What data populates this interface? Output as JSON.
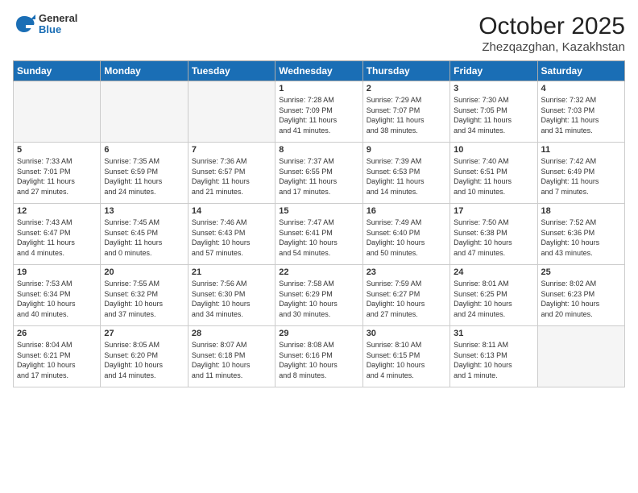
{
  "header": {
    "logo_general": "General",
    "logo_blue": "Blue",
    "month": "October 2025",
    "location": "Zhezqazghan, Kazakhstan"
  },
  "weekdays": [
    "Sunday",
    "Monday",
    "Tuesday",
    "Wednesday",
    "Thursday",
    "Friday",
    "Saturday"
  ],
  "weeks": [
    [
      {
        "day": "",
        "info": ""
      },
      {
        "day": "",
        "info": ""
      },
      {
        "day": "",
        "info": ""
      },
      {
        "day": "1",
        "info": "Sunrise: 7:28 AM\nSunset: 7:09 PM\nDaylight: 11 hours\nand 41 minutes."
      },
      {
        "day": "2",
        "info": "Sunrise: 7:29 AM\nSunset: 7:07 PM\nDaylight: 11 hours\nand 38 minutes."
      },
      {
        "day": "3",
        "info": "Sunrise: 7:30 AM\nSunset: 7:05 PM\nDaylight: 11 hours\nand 34 minutes."
      },
      {
        "day": "4",
        "info": "Sunrise: 7:32 AM\nSunset: 7:03 PM\nDaylight: 11 hours\nand 31 minutes."
      }
    ],
    [
      {
        "day": "5",
        "info": "Sunrise: 7:33 AM\nSunset: 7:01 PM\nDaylight: 11 hours\nand 27 minutes."
      },
      {
        "day": "6",
        "info": "Sunrise: 7:35 AM\nSunset: 6:59 PM\nDaylight: 11 hours\nand 24 minutes."
      },
      {
        "day": "7",
        "info": "Sunrise: 7:36 AM\nSunset: 6:57 PM\nDaylight: 11 hours\nand 21 minutes."
      },
      {
        "day": "8",
        "info": "Sunrise: 7:37 AM\nSunset: 6:55 PM\nDaylight: 11 hours\nand 17 minutes."
      },
      {
        "day": "9",
        "info": "Sunrise: 7:39 AM\nSunset: 6:53 PM\nDaylight: 11 hours\nand 14 minutes."
      },
      {
        "day": "10",
        "info": "Sunrise: 7:40 AM\nSunset: 6:51 PM\nDaylight: 11 hours\nand 10 minutes."
      },
      {
        "day": "11",
        "info": "Sunrise: 7:42 AM\nSunset: 6:49 PM\nDaylight: 11 hours\nand 7 minutes."
      }
    ],
    [
      {
        "day": "12",
        "info": "Sunrise: 7:43 AM\nSunset: 6:47 PM\nDaylight: 11 hours\nand 4 minutes."
      },
      {
        "day": "13",
        "info": "Sunrise: 7:45 AM\nSunset: 6:45 PM\nDaylight: 11 hours\nand 0 minutes."
      },
      {
        "day": "14",
        "info": "Sunrise: 7:46 AM\nSunset: 6:43 PM\nDaylight: 10 hours\nand 57 minutes."
      },
      {
        "day": "15",
        "info": "Sunrise: 7:47 AM\nSunset: 6:41 PM\nDaylight: 10 hours\nand 54 minutes."
      },
      {
        "day": "16",
        "info": "Sunrise: 7:49 AM\nSunset: 6:40 PM\nDaylight: 10 hours\nand 50 minutes."
      },
      {
        "day": "17",
        "info": "Sunrise: 7:50 AM\nSunset: 6:38 PM\nDaylight: 10 hours\nand 47 minutes."
      },
      {
        "day": "18",
        "info": "Sunrise: 7:52 AM\nSunset: 6:36 PM\nDaylight: 10 hours\nand 43 minutes."
      }
    ],
    [
      {
        "day": "19",
        "info": "Sunrise: 7:53 AM\nSunset: 6:34 PM\nDaylight: 10 hours\nand 40 minutes."
      },
      {
        "day": "20",
        "info": "Sunrise: 7:55 AM\nSunset: 6:32 PM\nDaylight: 10 hours\nand 37 minutes."
      },
      {
        "day": "21",
        "info": "Sunrise: 7:56 AM\nSunset: 6:30 PM\nDaylight: 10 hours\nand 34 minutes."
      },
      {
        "day": "22",
        "info": "Sunrise: 7:58 AM\nSunset: 6:29 PM\nDaylight: 10 hours\nand 30 minutes."
      },
      {
        "day": "23",
        "info": "Sunrise: 7:59 AM\nSunset: 6:27 PM\nDaylight: 10 hours\nand 27 minutes."
      },
      {
        "day": "24",
        "info": "Sunrise: 8:01 AM\nSunset: 6:25 PM\nDaylight: 10 hours\nand 24 minutes."
      },
      {
        "day": "25",
        "info": "Sunrise: 8:02 AM\nSunset: 6:23 PM\nDaylight: 10 hours\nand 20 minutes."
      }
    ],
    [
      {
        "day": "26",
        "info": "Sunrise: 8:04 AM\nSunset: 6:21 PM\nDaylight: 10 hours\nand 17 minutes."
      },
      {
        "day": "27",
        "info": "Sunrise: 8:05 AM\nSunset: 6:20 PM\nDaylight: 10 hours\nand 14 minutes."
      },
      {
        "day": "28",
        "info": "Sunrise: 8:07 AM\nSunset: 6:18 PM\nDaylight: 10 hours\nand 11 minutes."
      },
      {
        "day": "29",
        "info": "Sunrise: 8:08 AM\nSunset: 6:16 PM\nDaylight: 10 hours\nand 8 minutes."
      },
      {
        "day": "30",
        "info": "Sunrise: 8:10 AM\nSunset: 6:15 PM\nDaylight: 10 hours\nand 4 minutes."
      },
      {
        "day": "31",
        "info": "Sunrise: 8:11 AM\nSunset: 6:13 PM\nDaylight: 10 hours\nand 1 minute."
      },
      {
        "day": "",
        "info": ""
      }
    ]
  ]
}
